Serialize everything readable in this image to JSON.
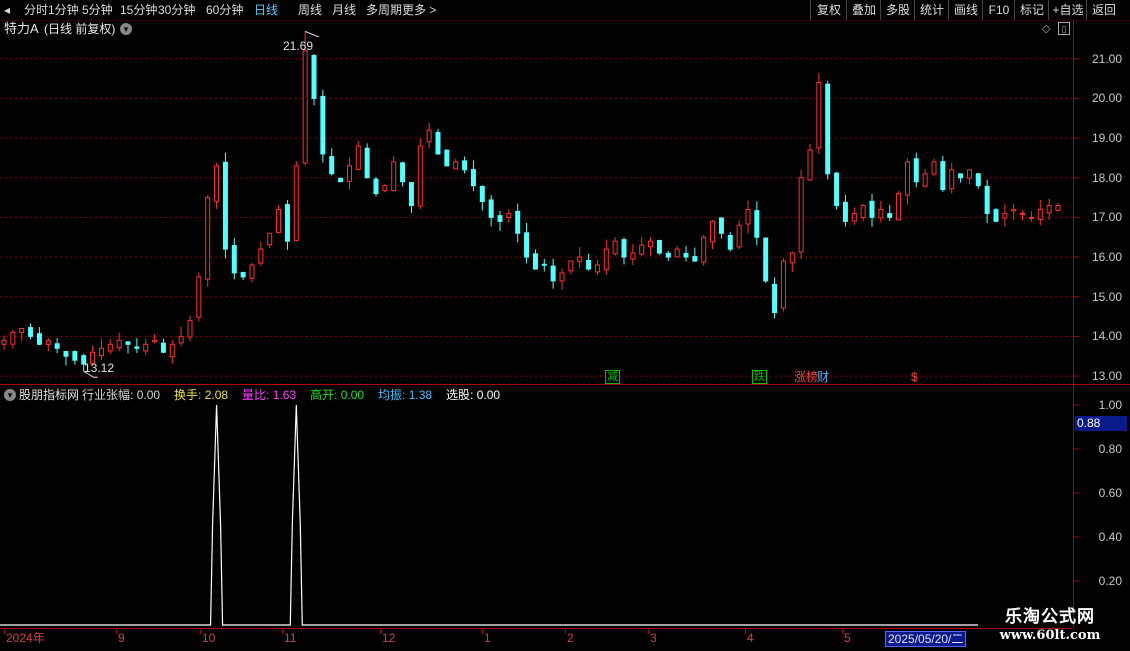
{
  "toolbar": {
    "periods": [
      "分时",
      "1分钟",
      "5分钟",
      "15分钟",
      "30分钟",
      "60分钟",
      "日线",
      "周线",
      "月线",
      "多周期",
      "更多"
    ],
    "active_period": "日线",
    "right_buttons": [
      "复权",
      "叠加",
      "多股",
      "统计",
      "画线",
      "F10",
      "标记",
      "+自选",
      "返回"
    ]
  },
  "stock": {
    "title": "特力A",
    "mode": "(日线 前复权)"
  },
  "main_chart": {
    "high_label": "21.69",
    "low_label": "13.12",
    "y_ticks": [
      "21.00",
      "20.00",
      "19.00",
      "18.00",
      "17.00",
      "16.00",
      "15.00",
      "14.00",
      "13.00"
    ],
    "markers": [
      {
        "text": "减",
        "color": "#00c000"
      },
      {
        "text": "跌",
        "color": "#00c000"
      },
      {
        "text": "涨",
        "color": "#ff4040"
      },
      {
        "text": "榜",
        "color": "#ff4040"
      },
      {
        "text": "财",
        "color": "#4fb0ff"
      },
      {
        "text": "$",
        "color": "#ff4040"
      }
    ]
  },
  "indicator": {
    "name": "股朋指标网",
    "items": [
      {
        "label": "行业张幅",
        "value": "0.00",
        "color": "#d8d8d8"
      },
      {
        "label": "换手",
        "value": "2.08",
        "color": "#f0e040"
      },
      {
        "label": "量比",
        "value": "1.63",
        "color": "#ff40ff"
      },
      {
        "label": "高开",
        "value": "0.00",
        "color": "#20e020"
      },
      {
        "label": "均振",
        "value": "1.38",
        "color": "#40c0ff"
      },
      {
        "label": "选股",
        "value": "0.00",
        "color": "#ffffff"
      }
    ],
    "y_ticks": [
      "1.00",
      "0.80",
      "0.60",
      "0.40",
      "0.20"
    ],
    "current_value": "0.88",
    "spikes": [
      {
        "date": "2024-09-30",
        "value": 1.0
      },
      {
        "date": "2024-10-31",
        "value": 1.0
      }
    ]
  },
  "x_axis": {
    "labels": [
      "2024年",
      "9",
      "10",
      "11",
      "12",
      "1",
      "2",
      "3",
      "4",
      "5"
    ],
    "cursor_date": "2025/05/20/二"
  },
  "watermark": {
    "line1": "乐淘公式网",
    "line2": "www.60lt.com"
  },
  "colors": {
    "up": "#ff3030",
    "down": "#54ffff",
    "grid": "#8a0000",
    "axis": "#b00000"
  },
  "chart_data": {
    "type": "candlestick",
    "title": "特力A (日线 前复权)",
    "ylim": [
      12.8,
      21.8
    ],
    "price_high": 21.69,
    "price_low": 13.12,
    "x_labels": [
      "2024年",
      "9",
      "10",
      "11",
      "12",
      "1",
      "2",
      "3",
      "4",
      "5"
    ],
    "series": [
      {
        "name": "close",
        "values": [
          13.9,
          14.1,
          14.2,
          14.0,
          13.8,
          13.9,
          13.7,
          13.5,
          13.4,
          13.3,
          13.6,
          13.7,
          13.8,
          13.9,
          13.8,
          13.7,
          13.8,
          13.9,
          13.6,
          13.8,
          14.0,
          14.4,
          15.5,
          17.5,
          18.3,
          16.2,
          15.6,
          15.5,
          15.8,
          16.2,
          16.6,
          17.2,
          16.4,
          18.3,
          21.2,
          20.0,
          18.6,
          18.1,
          17.9,
          18.3,
          18.8,
          18.0,
          17.6,
          17.8,
          18.4,
          17.9,
          17.3,
          18.8,
          19.2,
          18.6,
          18.3,
          18.4,
          18.2,
          17.8,
          17.4,
          17.0,
          16.9,
          17.1,
          16.6,
          16.0,
          15.7,
          15.8,
          15.4,
          15.6,
          15.9,
          16.0,
          15.7,
          15.8,
          16.2,
          16.4,
          16.0,
          16.1,
          16.3,
          16.4,
          16.1,
          16.0,
          16.2,
          16.0,
          15.9,
          16.5,
          16.9,
          16.6,
          16.2,
          16.8,
          17.2,
          16.5,
          15.4,
          14.6,
          15.9,
          16.1,
          18.0,
          18.7,
          20.4,
          18.1,
          17.3,
          16.9,
          17.1,
          17.3,
          17.0,
          17.2,
          17.0,
          17.6,
          18.4,
          17.9,
          18.1,
          18.4,
          17.7,
          18.2,
          18.0,
          18.2,
          17.8,
          17.1,
          16.9,
          17.1,
          17.2,
          17.1,
          17.0,
          17.2,
          17.3,
          17.3
        ]
      }
    ],
    "indicator_series": {
      "name": "股朋指标网",
      "ylim": [
        0,
        1.05
      ],
      "spike_dates": [
        "2024-09-30",
        "2024-10-31"
      ]
    }
  }
}
